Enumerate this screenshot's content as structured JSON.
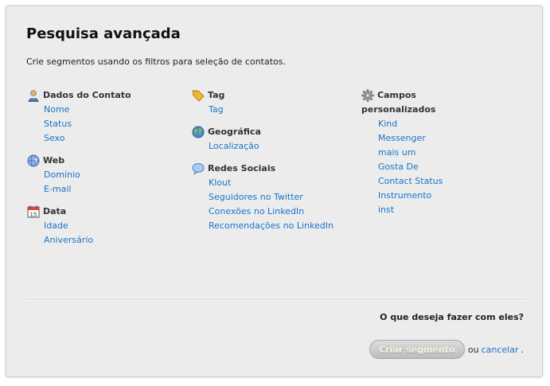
{
  "dialog": {
    "title": "Pesquisa avançada",
    "subtitle": "Crie segmentos usando os filtros para seleção de contatos."
  },
  "groups": {
    "contact": {
      "title": "Dados do Contato",
      "icon": "user-icon",
      "links": [
        "Nome",
        "Status",
        "Sexo"
      ]
    },
    "web": {
      "title": "Web",
      "icon": "globe-icon",
      "links": [
        "Domínio",
        "E-mail"
      ]
    },
    "date": {
      "title": "Data",
      "icon": "calendar-icon",
      "calendar_day": "15",
      "links": [
        "Idade",
        "Aniversário"
      ]
    },
    "tag": {
      "title": "Tag",
      "icon": "tag-icon",
      "links": [
        "Tag"
      ]
    },
    "geo": {
      "title": "Geográfica",
      "icon": "earth-icon",
      "links": [
        "Localização"
      ]
    },
    "social": {
      "title": "Redes Sociais",
      "icon": "speech-bubble-icon",
      "links": [
        "Klout",
        "Seguidores no Twitter",
        "Conexões no LinkedIn",
        "Recomendações no LinkedIn"
      ]
    },
    "custom": {
      "title_line1": "Campos",
      "title_line2": "personalizados",
      "icon": "gear-icon",
      "links": [
        "Kind",
        "Messenger",
        "mais um",
        "Gosta De",
        "Contact Status",
        "Instrumento",
        "inst"
      ]
    }
  },
  "footer": {
    "question": "O que deseja fazer com eles?",
    "create_button": "Criar segmento",
    "or_text": "ou",
    "cancel_link": "cancelar",
    "period": "."
  },
  "colors": {
    "link": "#1a74c9",
    "panel_bg": "#ececec",
    "button_bg": "#c8c8c8"
  }
}
